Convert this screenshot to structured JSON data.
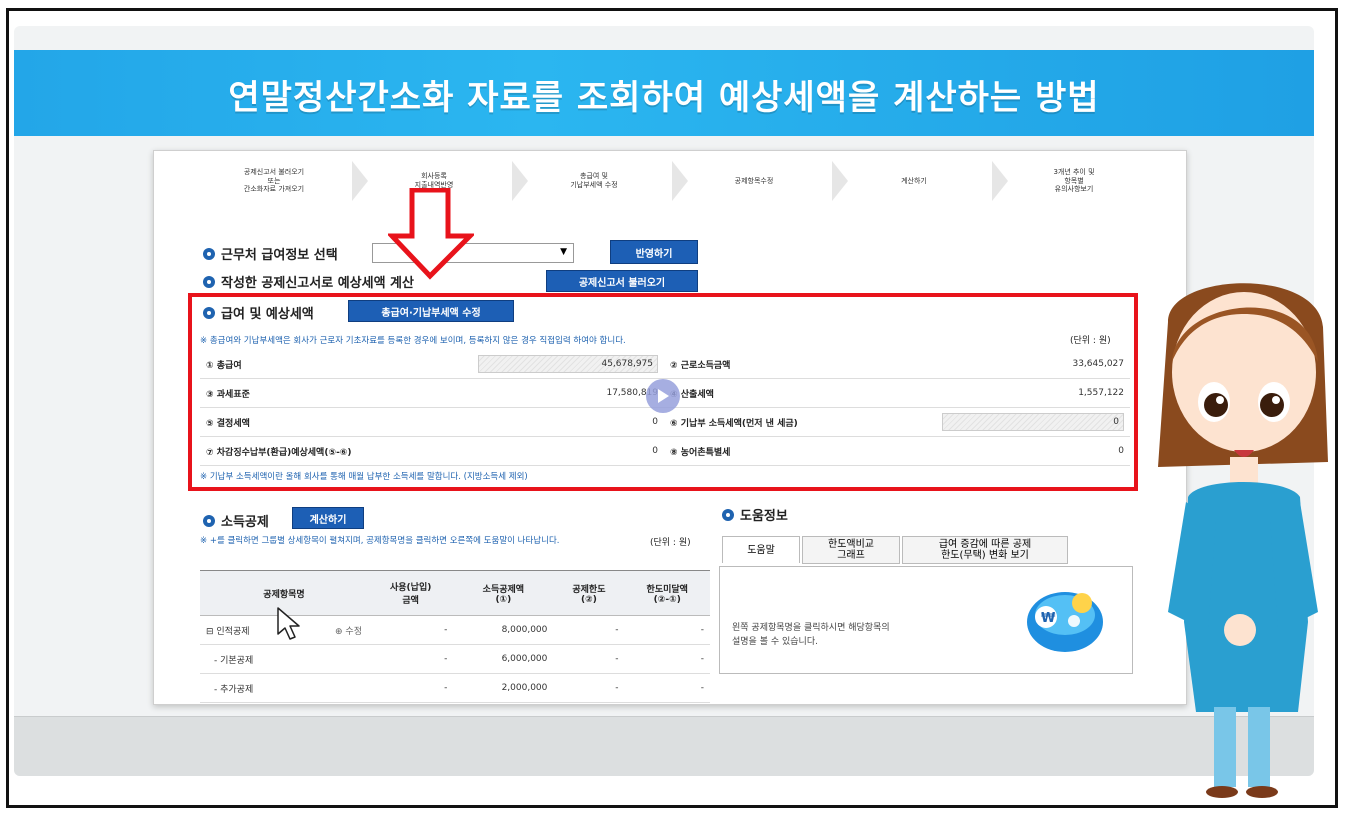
{
  "slide": {
    "title": "연말정산간소화 자료를 조회하여 예상세액을 계산하는 방법"
  },
  "steps": [
    "공제신고서 불러오기\n또는\n간소화자료 가져오기",
    "회사등록\n지출내역반영",
    "총급여 및\n기납부세액 수정",
    "공제항목수정",
    "계산하기",
    "3개년 추이 및\n항목별\n유의사항보기"
  ],
  "sections": {
    "workplace": "근무처 급여정보 선택",
    "workplace_button": "반영하기",
    "written": "작성한 공제신고서로 예상세액 계산",
    "written_button": "공제신고서 불러오기",
    "salary": "급여 및 예상세액",
    "salary_button": "총급여·기납부세액 수정"
  },
  "salary_note": "※ 총급여와 기납부세액은 회사가 근로자 기초자료를 등록한 경우에 보이며, 등록하지 않은 경우 직접입력 하여야 합니다.",
  "unit_label": "(단위 : 원)",
  "tax_rows": [
    {
      "l1": "① 총급여",
      "v1": "45,678,975",
      "l2": "② 근로소득금액",
      "v2": "33,645,027"
    },
    {
      "l1": "③ 과세표준",
      "v1": "17,580,819",
      "l2": "④ 산출세액",
      "v2": "1,557,122"
    },
    {
      "l1": "⑤ 결정세액",
      "v1": "0",
      "l2": "⑥ 기납부 소득세액(먼저 낸 세금)",
      "v2": "0"
    },
    {
      "l1": "⑦ 차감징수납부(환급)예상세액(⑤-⑥)",
      "v1": "0",
      "l2": "⑧ 농어촌특별세",
      "v2": "0"
    }
  ],
  "salary_footnote": "※ 기납부 소득세액이란 올해 회사를 통해 매월 납부한 소득세를 말합니다. (지방소득세 제외)",
  "deduction": {
    "title": "소득공제",
    "button": "계산하기",
    "note": "※ +를 클릭하면 그룹별 상세항목이 펼쳐지며, 공제항목명을 클릭하면 오른쪽에 도움말이 나타납니다.",
    "unit": "(단위 : 원)",
    "headers": [
      "공제항목명",
      "사용(납입)\n금액",
      "소득공제액\n(①)",
      "공제한도\n(②)",
      "한도미달액\n(②-①)"
    ],
    "rows": [
      {
        "name": "⊟ 인적공제",
        "edit": "⊕ 수정",
        "used": "-",
        "amount": "8,000,000",
        "limit": "-",
        "under": "-"
      },
      {
        "name": "- 기본공제",
        "edit": "",
        "used": "-",
        "amount": "6,000,000",
        "limit": "-",
        "under": "-"
      },
      {
        "name": "- 추가공제",
        "edit": "",
        "used": "-",
        "amount": "2,000,000",
        "limit": "-",
        "under": "-"
      }
    ]
  },
  "help": {
    "title": "도움정보",
    "tabs": [
      "도움말",
      "한도액비교\n그래프",
      "급여 증감에 따른 공제\n한도(무택) 변화 보기"
    ],
    "text": "왼쪽 공제항목명을 클릭하시면 해당항목의\n설명을 볼 수 있습니다."
  },
  "colors": {
    "banner": "#23a6e8",
    "accent": "#1d5fb5",
    "highlight": "#e8131b"
  }
}
